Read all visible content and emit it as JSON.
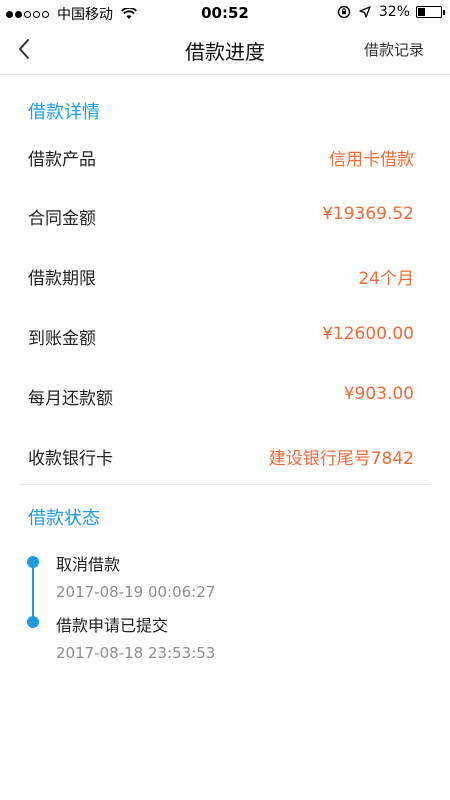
{
  "status_bar": {
    "carrier": "中国移动",
    "time": "00:52",
    "battery": "32%",
    "battery_level": 0.32,
    "icons": [
      "signal-icon",
      "wifi-icon",
      "lock-rotation-icon",
      "location-icon",
      "battery-icon"
    ]
  },
  "nav": {
    "title": "借款进度",
    "action": "借款记录",
    "back_icon": "chevron-left-icon"
  },
  "details": {
    "title": "借款详情",
    "rows": [
      {
        "label": "借款产品",
        "value": "信用卡借款"
      },
      {
        "label": "合同金额",
        "value": "¥19369.52"
      },
      {
        "label": "借款期限",
        "value": "24个月"
      },
      {
        "label": "到账金额",
        "value": "¥12600.00"
      },
      {
        "label": "每月还款额",
        "value": "¥903.00"
      },
      {
        "label": "收款银行卡",
        "value": "建设银行尾号7842"
      }
    ]
  },
  "status": {
    "title": "借款状态",
    "events": [
      {
        "title": "取消借款",
        "time": "2017-08-19 00:06:27"
      },
      {
        "title": "借款申请已提交",
        "time": "2017-08-18 23:53:53"
      }
    ]
  },
  "colors": {
    "accent": "#1e9be6",
    "value": "#f26b3a",
    "muted": "#8e8e8e"
  }
}
